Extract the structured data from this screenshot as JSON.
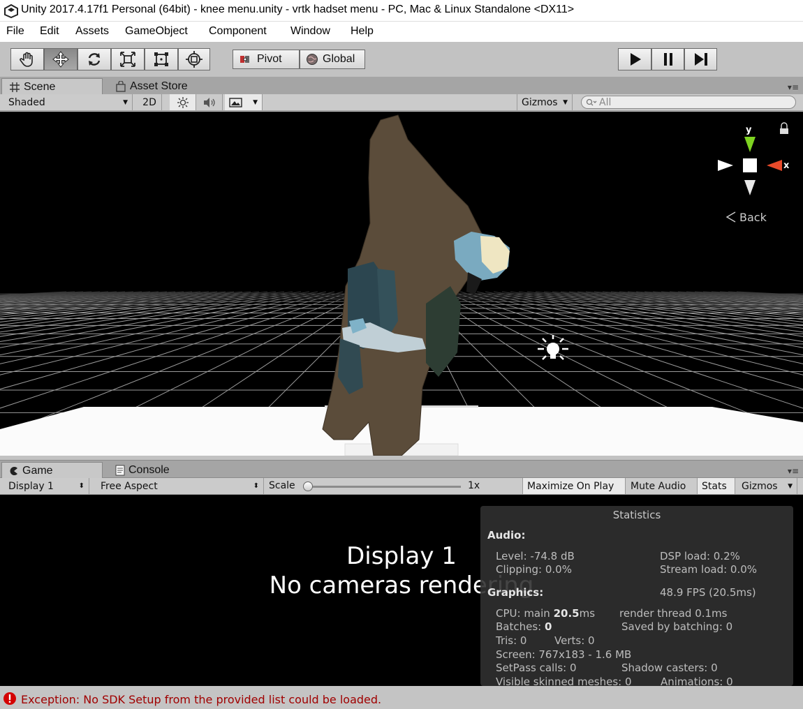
{
  "window": {
    "title": "Unity 2017.4.17f1 Personal (64bit) - knee menu.unity - vrtk hadset menu - PC, Mac & Linux Standalone <DX11>"
  },
  "menu": [
    "File",
    "Edit",
    "Assets",
    "GameObject",
    "Component",
    "Window",
    "Help"
  ],
  "toolbar": {
    "tools": [
      "hand-tool-icon",
      "move-tool-icon",
      "rotate-tool-icon",
      "scale-tool-icon",
      "rect-tool-icon",
      "transform-tool-icon"
    ],
    "active_tool": "move-tool-icon",
    "pivot_label": "Pivot",
    "global_label": "Global",
    "playback": [
      "play-icon",
      "pause-icon",
      "step-icon"
    ]
  },
  "scene_panel": {
    "tabs": [
      {
        "label": "Scene",
        "icon": "grid-icon",
        "active": true
      },
      {
        "label": "Asset Store",
        "icon": "store-icon",
        "active": false
      }
    ],
    "shading_mode": "Shaded",
    "mode_2d": "2D",
    "gizmos_label": "Gizmos",
    "search_placeholder": "All",
    "gizmo_axes": {
      "y": "y",
      "x": "x"
    },
    "back_label": "Back"
  },
  "game_panel": {
    "tabs": [
      {
        "label": "Game",
        "icon": "pacman-icon",
        "active": true
      },
      {
        "label": "Console",
        "icon": "console-icon",
        "active": false
      }
    ],
    "display": "Display 1",
    "aspect": "Free Aspect",
    "scale_label": "Scale",
    "scale_value": "1x",
    "scale_fraction": 0.0,
    "buttons": {
      "maximize": "Maximize On Play",
      "mute": "Mute Audio",
      "stats": "Stats",
      "gizmos": "Gizmos"
    },
    "no_camera_title": "Display 1",
    "no_camera_msg": "No cameras rendering"
  },
  "statistics": {
    "heading": "Statistics",
    "audio_label": "Audio:",
    "level": "Level: -74.8 dB",
    "clipping": "Clipping: 0.0%",
    "dsp_load": "DSP load: 0.2%",
    "stream_load": "Stream load: 0.0%",
    "graphics_label": "Graphics:",
    "fps": "48.9 FPS (20.5ms)",
    "cpu_prefix": "CPU: main ",
    "cpu_main": "20.5",
    "cpu_suffix": "ms",
    "render_thread": "render thread 0.1ms",
    "batches_prefix": "Batches: ",
    "batches": "0",
    "saved_by_batching": "Saved by batching: 0",
    "tris": "Tris: 0",
    "verts": "Verts: 0",
    "screen": "Screen: 767x183 - 1.6 MB",
    "setpass": "SetPass calls: 0",
    "shadow_casters": "Shadow casters: 0",
    "skinned_meshes": "Visible skinned meshes: 0",
    "animations": "Animations: 0"
  },
  "status": {
    "message": "Exception: No SDK Setup from the provided list could be loaded.",
    "error_color": "#d40000"
  }
}
